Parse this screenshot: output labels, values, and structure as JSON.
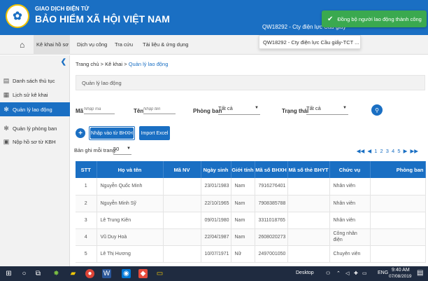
{
  "header": {
    "subtitle": "GIAO DỊCH ĐIỆN TỬ",
    "title": "BẢO HIỂM XÃ HỘI VIỆT NAM",
    "company": "QW18292 - Cty điện lực Cầu giấy",
    "company_option": "QW18292 - Cty điện lực Cầu giấy-TCT ..."
  },
  "toast": {
    "message": "Đồng bộ người lao động thành công"
  },
  "nav": {
    "items": [
      "Kê khai hồ sơ",
      "Dịch vụ công",
      "Tra cứu",
      "Tài liệu & ứng dụng"
    ]
  },
  "sidebar": {
    "items": [
      "Danh sách thủ tục",
      "Lịch sử kê khai",
      "Quản lý lao động",
      "Quản lý phòng ban",
      "Nộp hồ sơ từ KBH"
    ]
  },
  "breadcrumb": {
    "home": "Trang chủ",
    "sep": ">",
    "section": "Kê khai",
    "current": "Quản lý lao động"
  },
  "panel": {
    "title": "Quản lý lao động"
  },
  "filters": {
    "ma_label": "Mã",
    "ma_placeholder": "Nhập mã",
    "ten_label": "Tên",
    "ten_placeholder": "Nhập tên",
    "phongban_label": "Phòng ban",
    "phongban_value": "Tất cả",
    "trangthai_label": "Trạng thái",
    "trangthai_value": "Tất cả"
  },
  "actions": {
    "import_bhxh": "Nhập vào từ BHXH",
    "import_excel": "Import Excel"
  },
  "paging": {
    "label": "Bản ghi mỗi trang:",
    "page_size": "50",
    "pages": [
      "1",
      "2",
      "3",
      "4",
      "5"
    ]
  },
  "table": {
    "headers": [
      "STT",
      "Họ và tên",
      "Mã NV",
      "Ngày sinh",
      "Giới tính",
      "Mã số BHXH",
      "Mã số thẻ BHYT",
      "Chức vụ",
      "Phòng ban"
    ],
    "rows": [
      [
        "1",
        "Nguyễn Quốc Minh",
        "",
        "23/01/1983",
        "Nam",
        "7916276401",
        "",
        "Nhân viên",
        ""
      ],
      [
        "2",
        "Nguyễn Minh Sỹ",
        "",
        "22/10/1965",
        "Nam",
        "7908385788",
        "",
        "Nhân viên",
        ""
      ],
      [
        "3",
        "Lê Trung Kiên",
        "",
        "09/01/1980",
        "Nam",
        "3311018765",
        "",
        "Nhân viên",
        ""
      ],
      [
        "4",
        "Vũ Duy Hoà",
        "",
        "22/04/1987",
        "Nam",
        "2608020273",
        "",
        "Công nhân điện",
        ""
      ],
      [
        "5",
        "Lê Thị Hương",
        "",
        "10/07/1971",
        "Nữ",
        "2497001050",
        "",
        "Chuyên viên",
        ""
      ]
    ]
  },
  "taskbar": {
    "desktop": "Desktop",
    "lang": "ENG",
    "time": "9:40 AM",
    "date": "07/08/2019"
  },
  "colors": {
    "primary": "#1a6fc3",
    "success": "#3aa94f",
    "taskbar": "#1f2b40"
  }
}
